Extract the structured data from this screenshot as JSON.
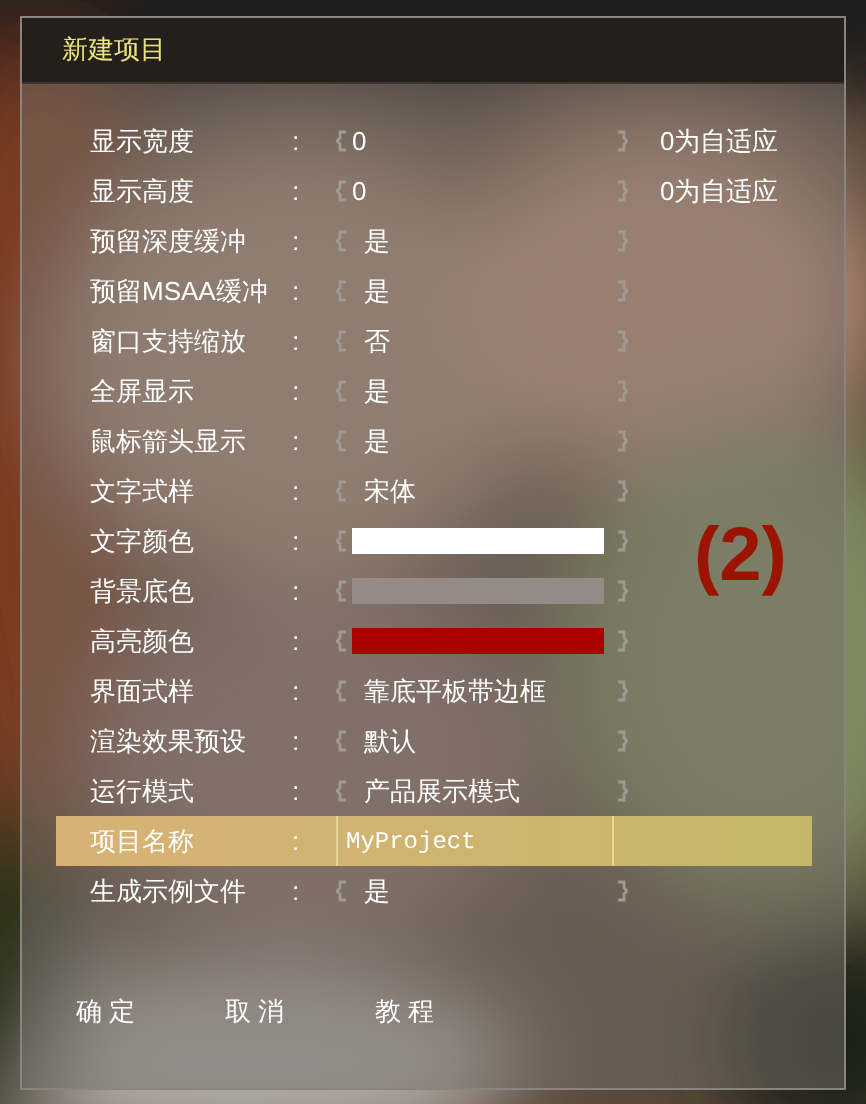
{
  "window": {
    "title": "新建项目"
  },
  "rows": [
    {
      "kind": "number",
      "label": "显示宽度",
      "colon": ":",
      "value": "0",
      "note": "0为自适应",
      "selected": false
    },
    {
      "kind": "number",
      "label": "显示高度",
      "colon": ":",
      "value": "0",
      "note": "0为自适应",
      "selected": false
    },
    {
      "kind": "option",
      "label": "预留深度缓冲",
      "colon": ":",
      "value": "是",
      "selected": false
    },
    {
      "kind": "option",
      "label": "预留MSAA缓冲",
      "colon": ":",
      "value": "是",
      "selected": false
    },
    {
      "kind": "option",
      "label": "窗口支持缩放",
      "colon": ":",
      "value": "否",
      "selected": false
    },
    {
      "kind": "option",
      "label": "全屏显示",
      "colon": ":",
      "value": "是",
      "selected": false
    },
    {
      "kind": "option",
      "label": "鼠标箭头显示",
      "colon": ":",
      "value": "是",
      "selected": false
    },
    {
      "kind": "option",
      "label": "文字式样",
      "colon": ":",
      "value": "宋体",
      "selected": false
    },
    {
      "kind": "color",
      "label": "文字颜色",
      "colon": ":",
      "color": "#ffffff",
      "selected": false
    },
    {
      "kind": "color",
      "label": "背景底色",
      "colon": ":",
      "color": "#948a88",
      "selected": false
    },
    {
      "kind": "color",
      "label": "高亮颜色",
      "colon": ":",
      "color": "#aa0000",
      "selected": false
    },
    {
      "kind": "option",
      "label": "界面式样",
      "colon": ":",
      "value": "靠底平板带边框",
      "selected": false
    },
    {
      "kind": "option",
      "label": "渲染效果预设",
      "colon": ":",
      "value": "默认",
      "selected": false
    },
    {
      "kind": "option",
      "label": "运行模式",
      "colon": ":",
      "value": "产品展示模式",
      "selected": false
    },
    {
      "kind": "text",
      "label": "项目名称",
      "colon": ":",
      "value": "MyProject",
      "selected": true
    },
    {
      "kind": "option",
      "label": "生成示例文件",
      "colon": ":",
      "value": "是",
      "selected": false
    }
  ],
  "annotation": "(2)",
  "buttons": [
    "确 定",
    "取 消",
    "教 程"
  ]
}
